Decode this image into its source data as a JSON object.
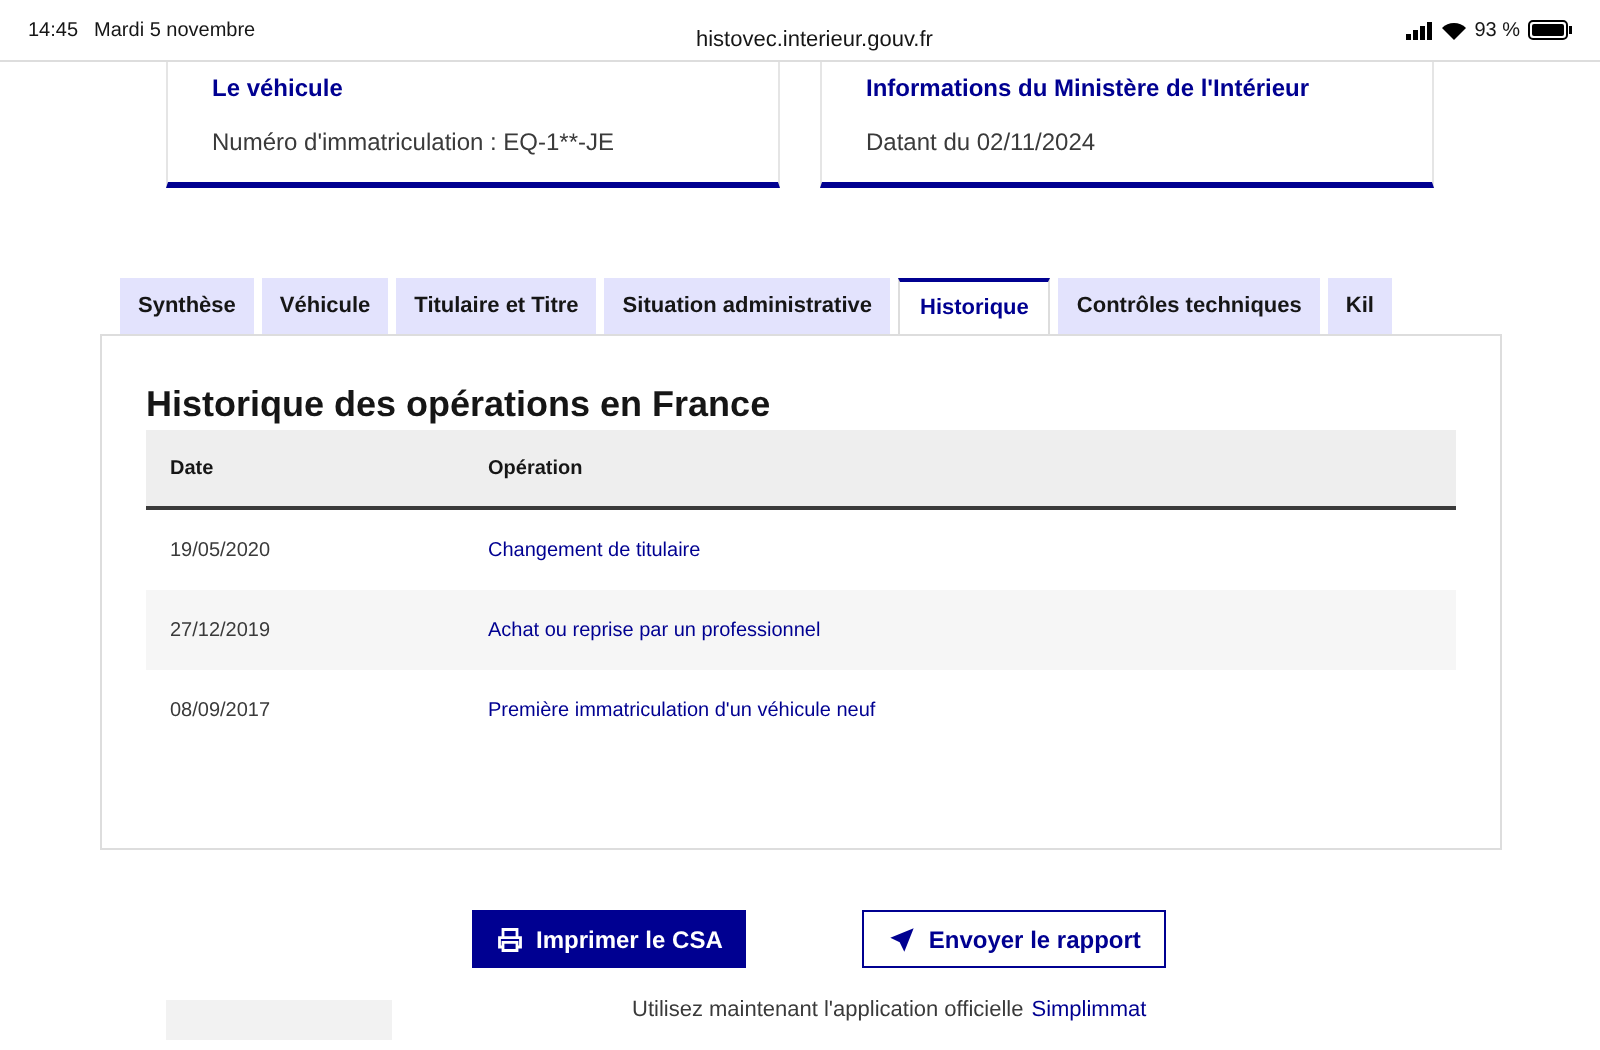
{
  "status_bar": {
    "time": "14:45",
    "date": "Mardi 5 novembre",
    "battery": "93 %",
    "url": "histovec.interieur.gouv.fr"
  },
  "cards": [
    {
      "title": "Le véhicule",
      "text": "Numéro d'immatriculation : EQ-1**-JE"
    },
    {
      "title": "Informations du Ministère de l'Intérieur",
      "text": "Datant du 02/11/2024"
    }
  ],
  "tabs": [
    {
      "label": "Synthèse",
      "selected": false
    },
    {
      "label": "Véhicule",
      "selected": false
    },
    {
      "label": "Titulaire et Titre",
      "selected": false
    },
    {
      "label": "Situation administrative",
      "selected": false
    },
    {
      "label": "Historique",
      "selected": true
    },
    {
      "label": "Contrôles techniques",
      "selected": false
    },
    {
      "label": "Kil",
      "selected": false
    }
  ],
  "panel": {
    "title": "Historique des opérations en France",
    "table": {
      "columns": [
        "Date",
        "Opération"
      ],
      "rows": [
        [
          "19/05/2020",
          "Changement de titulaire"
        ],
        [
          "27/12/2019",
          "Achat ou reprise par un professionnel"
        ],
        [
          "08/09/2017",
          "Première immatriculation d'un véhicule neuf"
        ]
      ]
    }
  },
  "buttons": [
    {
      "label": "Imprimer le CSA",
      "kind": "primary"
    },
    {
      "label": "Envoyer le rapport",
      "kind": "secondary"
    }
  ],
  "footer": {
    "text": "Utilisez maintenant l'application officielle",
    "link": "Simplimmat"
  }
}
